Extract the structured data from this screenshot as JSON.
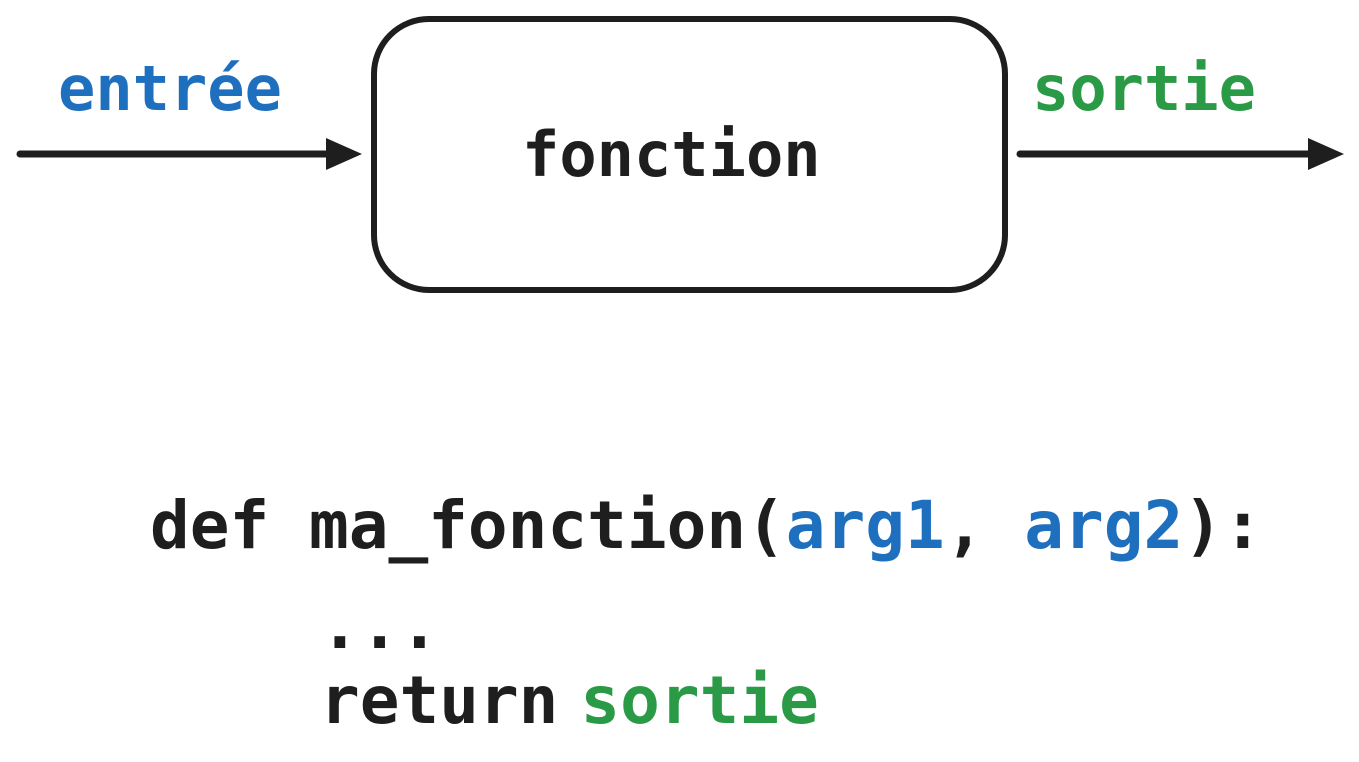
{
  "diagram": {
    "input_label": "entrée",
    "function_label": "fonction",
    "output_label": "sortie"
  },
  "code": {
    "line1": {
      "keyword": "def",
      "name": "ma_fonction(",
      "arg1": "arg1",
      "comma": ",",
      "arg2": "arg2",
      "close": "):"
    },
    "line2": {
      "ellipsis": "..."
    },
    "line3": {
      "keyword": "return",
      "value": "sortie"
    }
  },
  "colors": {
    "input": "#1f6fbf",
    "output": "#2a9a46",
    "stroke": "#1e1e1e"
  }
}
